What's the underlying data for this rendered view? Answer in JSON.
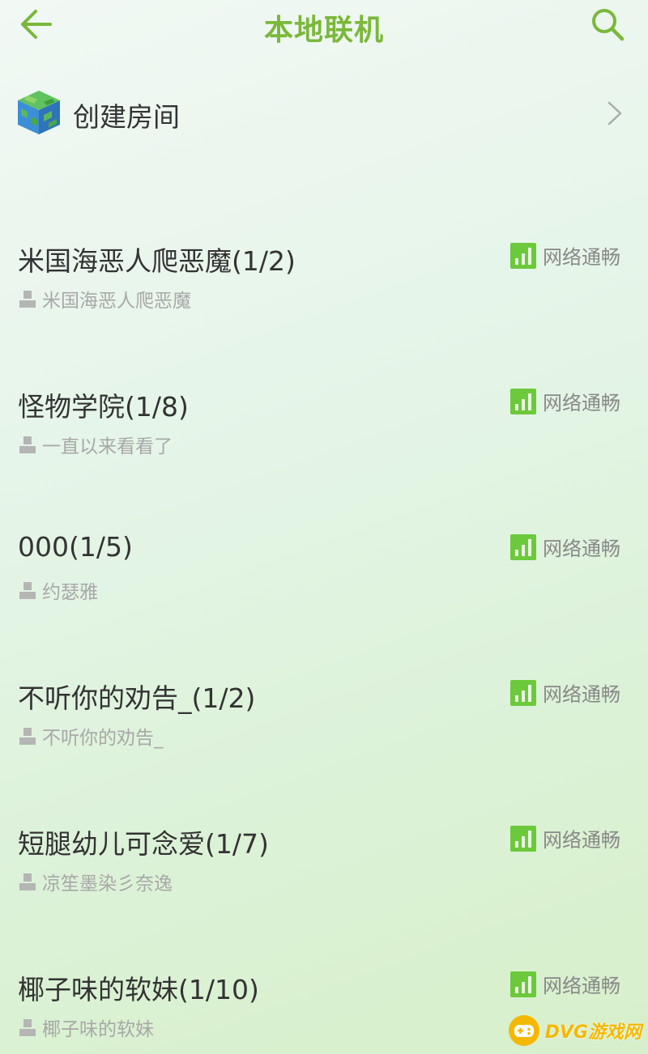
{
  "header": {
    "title": "本地联机"
  },
  "create_room": {
    "label": "创建房间"
  },
  "rooms": [
    {
      "name": "米国海恶人爬恶魔(1/2)",
      "status": "网络通畅",
      "host": "米国海恶人爬恶魔"
    },
    {
      "name": "怪物学院(1/8)",
      "status": "网络通畅",
      "host": "一直以来看看了"
    },
    {
      "name": "000(1/5)",
      "status": "网络通畅",
      "host": "约瑟雅"
    },
    {
      "name": "不听你的劝告_(1/2)",
      "status": "网络通畅",
      "host": "不听你的劝告_"
    },
    {
      "name": "短腿幼儿可念爱(1/7)",
      "status": "网络通畅",
      "host": "凉笙墨染彡奈逸"
    },
    {
      "name": "椰子味的软妹(1/10)",
      "status": "网络通畅",
      "host": "椰子味的软妹"
    }
  ],
  "watermark": {
    "text": "DVG游戏网"
  },
  "colors": {
    "accent": "#7ab83a",
    "signal": "#6cc93c",
    "host_text": "#a8a8a8"
  },
  "icons": {
    "back": "arrow-left-icon",
    "search": "search-icon",
    "globe": "minecraft-globe-icon",
    "chevron": "chevron-right-icon",
    "signal": "signal-bars-icon",
    "person": "person-icon"
  }
}
